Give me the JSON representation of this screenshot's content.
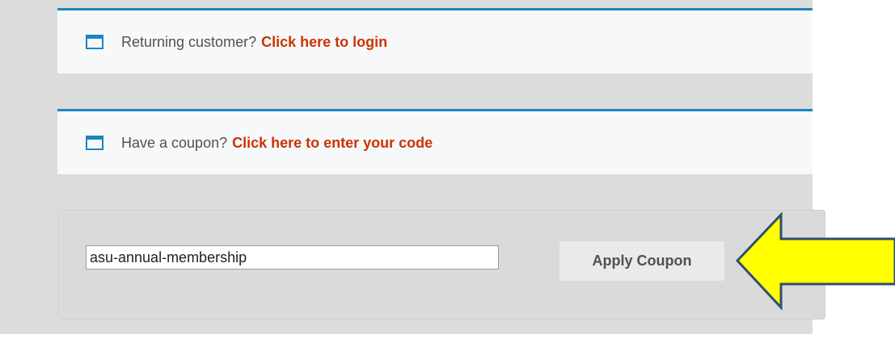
{
  "notices": {
    "login": {
      "text": "Returning customer?",
      "link": "Click here to login",
      "icon": "window-icon"
    },
    "coupon": {
      "text": "Have a coupon?",
      "link": "Click here to enter your code",
      "icon": "window-icon"
    }
  },
  "coupon_form": {
    "code_value": "asu-annual-membership",
    "apply_label": "Apply Coupon"
  },
  "annotation": {
    "arrow_color": "#ffff00",
    "arrow_outline": "#2f4f6f"
  },
  "colors": {
    "accent_border": "#1e85be",
    "link": "#cc3300",
    "background": "#dcdcdc"
  }
}
